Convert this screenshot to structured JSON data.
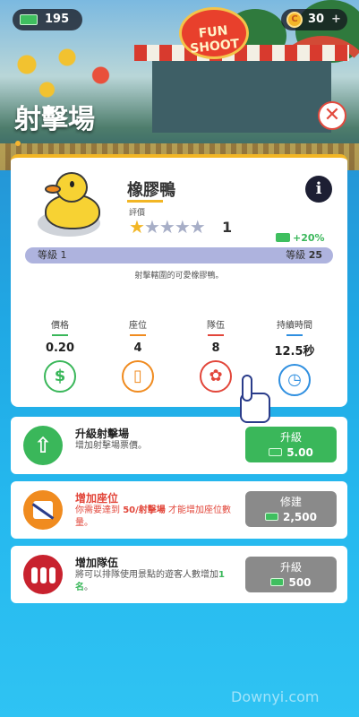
{
  "topbar": {
    "cash": "195",
    "coins": "30",
    "coins_plus": "+",
    "sign_text": "FUN SHOOT"
  },
  "header": {
    "title": "射擊場",
    "close_symbol": "✕"
  },
  "item": {
    "name": "橡膠鴨",
    "rating_label": "評價",
    "stars_filled": 1,
    "stars_total": 5,
    "rating_count": "1",
    "bonus": "+20%",
    "info_symbol": "i",
    "level_left": "等級 1",
    "level_right_label": "等級",
    "level_right_value": "25",
    "description": "射擊轄圍的可愛橡膠鴨。"
  },
  "stats": [
    {
      "label": "價格",
      "value": "0.20",
      "icon": "dollar-icon",
      "symbol": "$",
      "color": "#3ab75a"
    },
    {
      "label": "座位",
      "value": "4",
      "icon": "seat-icon",
      "symbol": "▯",
      "color": "#f08b1f"
    },
    {
      "label": "隊伍",
      "value": "8",
      "icon": "queue-icon",
      "symbol": "✿",
      "color": "#e2463a"
    },
    {
      "label": "持續時間",
      "value": "12.5秒",
      "icon": "clock-icon",
      "symbol": "◷",
      "color": "#2f8fe0"
    }
  ],
  "upgrades": [
    {
      "title": "升級射擊場",
      "subtitle": "增加射擊場票價。",
      "button_label": "升級",
      "button_value": "5.00",
      "button_color": "#3ab75a",
      "title_color": "#222",
      "icon": "up-arrow-icon"
    },
    {
      "title": "增加座位",
      "subtitle_pre": "你需要達到 ",
      "subtitle_highlight": "50/射擊場",
      "subtitle_post": " 才能增加座位數量。",
      "button_label": "修建",
      "button_value": "2,500",
      "button_color": "#8a8a8a",
      "title_color": "#e2463a",
      "icon": "seat-icon"
    },
    {
      "title": "增加隊伍",
      "subtitle_pre": "將可以排隊使用景點的遊客人數增加",
      "subtitle_highlight": "1 名",
      "subtitle_post": "。",
      "button_label": "升級",
      "button_value": "500",
      "button_color": "#8a8a8a",
      "title_color": "#222",
      "icon": "people-icon"
    }
  ],
  "watermark": "Downyi.com"
}
